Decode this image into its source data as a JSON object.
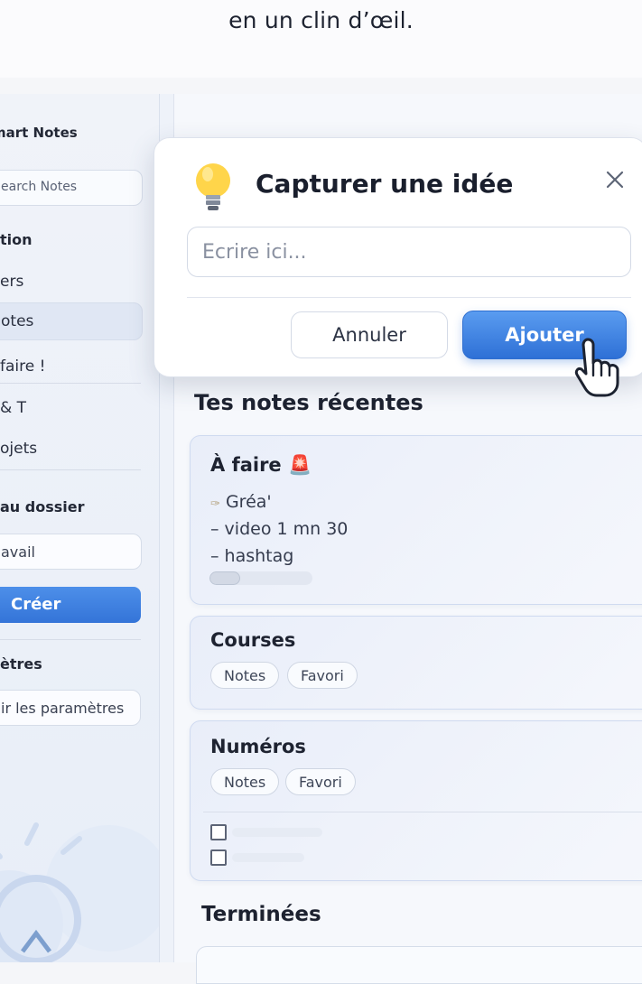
{
  "caption": "en un clin d’œil.",
  "app": {
    "name": "mart Notes"
  },
  "sidebar": {
    "search_placeholder": "earch Notes",
    "section_nav": "tion",
    "items": [
      {
        "label": "ers",
        "active": false
      },
      {
        "label": "otes",
        "active": true
      },
      {
        "label": "faire !",
        "active": false
      },
      {
        "label": "& T",
        "active": false
      },
      {
        "label": "ojets",
        "active": false
      }
    ],
    "section_folder": "au dossier",
    "folder_input_value": "avail",
    "create_label": "Créer",
    "section_params": "ètres",
    "params_label": "ir les paramètres"
  },
  "modal": {
    "bulb_icon": "lightbulb-icon",
    "title": "Capturer une idée",
    "input_placeholder": "Ecrire ici...",
    "cancel_label": "Annuler",
    "add_label": "Ajouter",
    "close_icon": "close-icon"
  },
  "main": {
    "recent_title": "Tes notes récentes",
    "notes": [
      {
        "title": "À faire 🚨",
        "lines": [
          "Gréa'",
          "– video 1 mn 30",
          "– hashtag"
        ],
        "line_icon": "pin-icon",
        "progress": 0.3
      },
      {
        "title": "Courses",
        "tags": [
          "Notes",
          "Favori"
        ]
      },
      {
        "title": "Numéros",
        "tags": [
          "Notes",
          "Favori"
        ],
        "checklist_items": 2
      }
    ],
    "done_title": "Terminées"
  },
  "colors": {
    "accent": "#3474d8",
    "background": "#f6f8fc",
    "sidebar": "#eef2f9"
  }
}
